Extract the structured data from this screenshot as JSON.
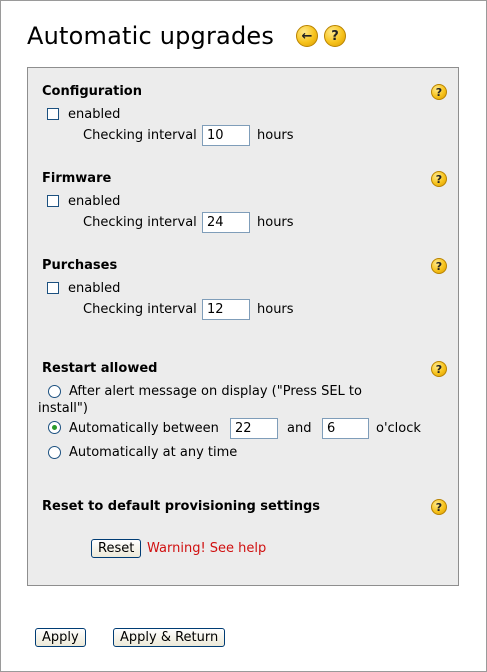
{
  "header": {
    "title": "Automatic upgrades",
    "back_glyph": "←",
    "help_glyph": "?"
  },
  "icons": {
    "back": "arrow-left-icon",
    "help": "help-icon",
    "help_glyph": "?"
  },
  "sections": {
    "configuration": {
      "title": "Configuration",
      "enabled_label": "enabled",
      "enabled": false,
      "interval_label": "Checking interval",
      "interval_value": "10",
      "unit": "hours"
    },
    "firmware": {
      "title": "Firmware",
      "enabled_label": "enabled",
      "enabled": false,
      "interval_label": "Checking interval",
      "interval_value": "24",
      "unit": "hours"
    },
    "purchases": {
      "title": "Purchases",
      "enabled_label": "enabled",
      "enabled": false,
      "interval_label": "Checking interval",
      "interval_value": "12",
      "unit": "hours"
    }
  },
  "restart": {
    "title": "Restart allowed",
    "option_alert_line1": "After alert message on display (\"Press SEL to",
    "option_alert_line2": "install\")",
    "option_between_label": "Automatically between",
    "between_from": "22",
    "between_and": "and",
    "between_to": "6",
    "between_unit": "o'clock",
    "option_any_label": "Automatically at any time",
    "selected": "between"
  },
  "reset": {
    "title": "Reset to default provisioning settings",
    "button_label": "Reset",
    "warning": "Warning! See help"
  },
  "footer": {
    "apply_label": "Apply",
    "apply_return_label": "Apply & Return"
  },
  "colors": {
    "panel_bg": "#ececec",
    "warning": "#d01010",
    "help_icon": "#f7c31c"
  }
}
